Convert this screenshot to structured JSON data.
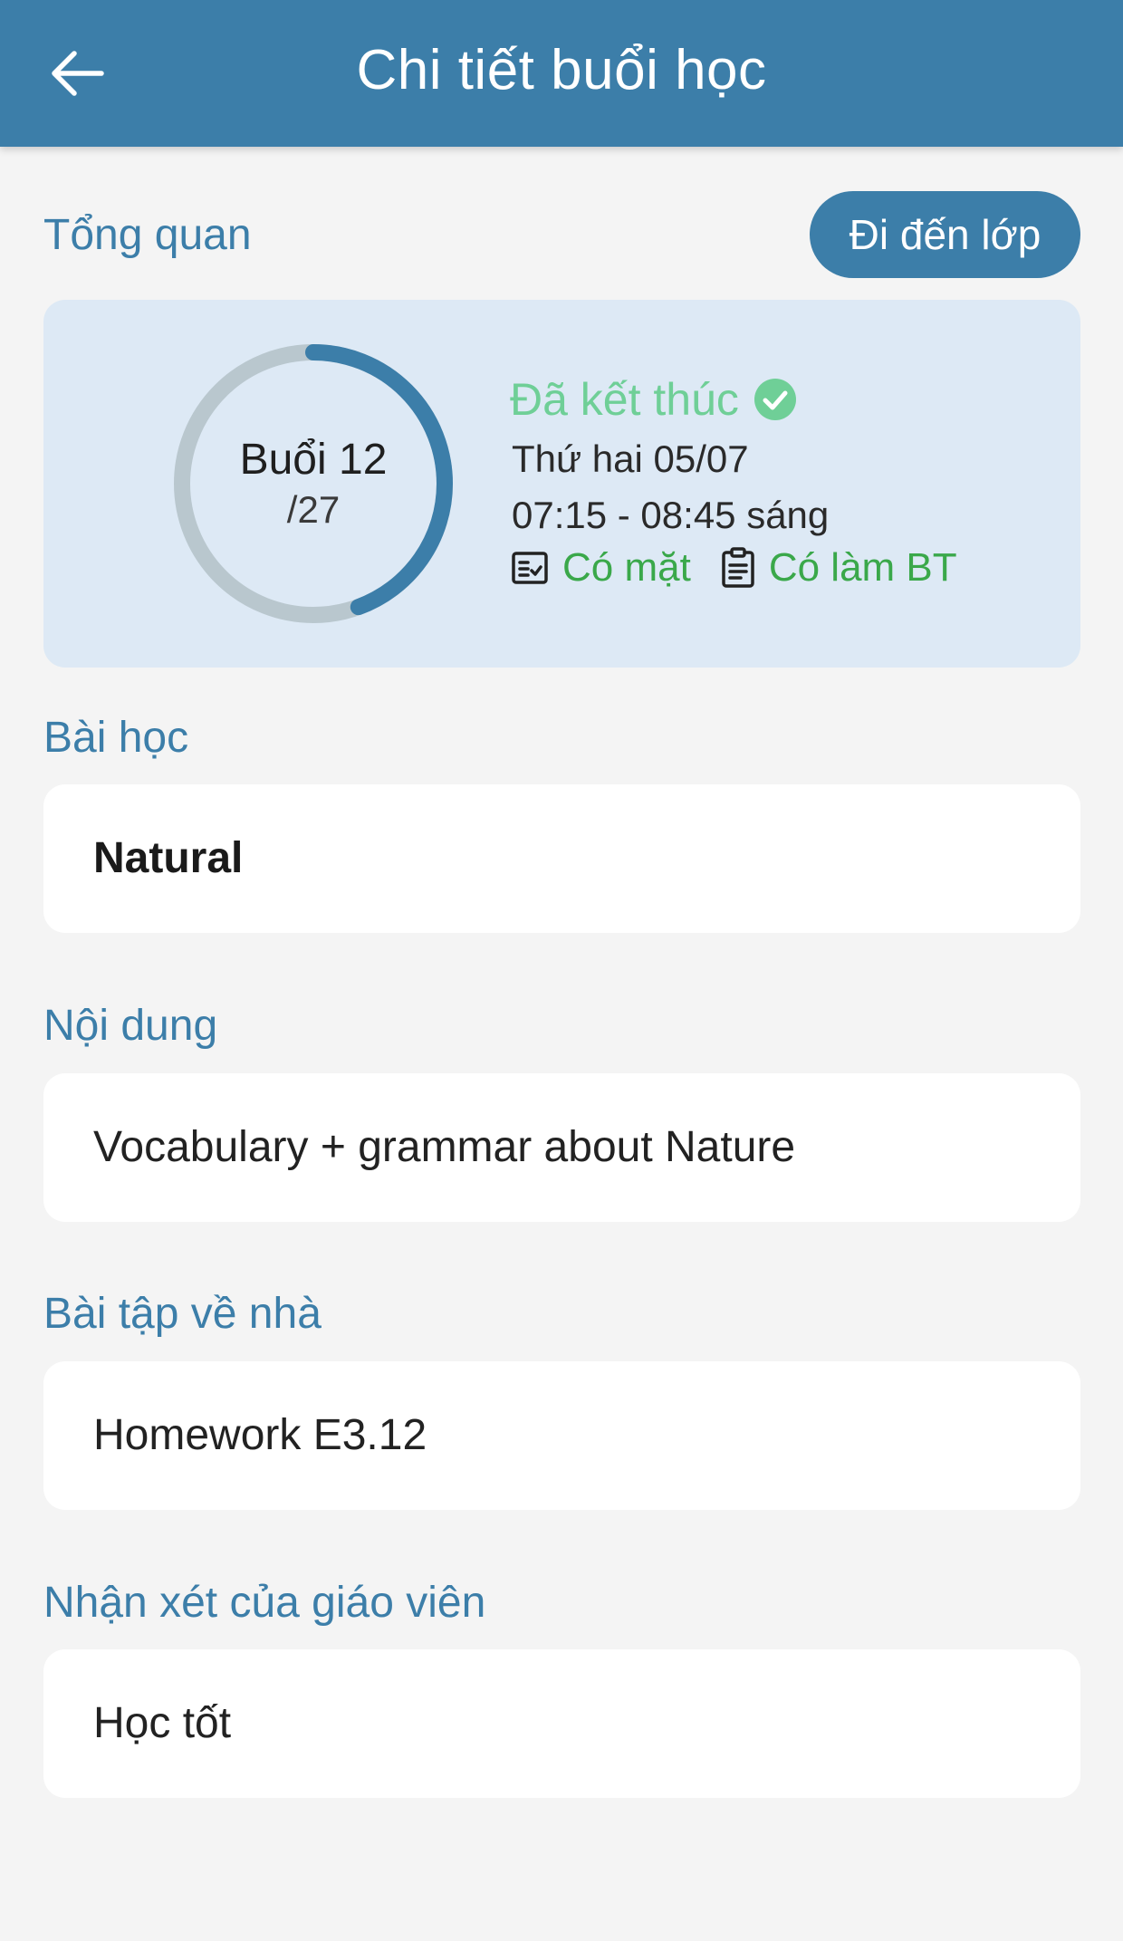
{
  "header": {
    "title": "Chi tiết buổi học"
  },
  "overview": {
    "section_title": "Tổng quan",
    "go_to_class_label": "Đi đến lớp",
    "session_label": "Buổi 12",
    "session_total": "/27",
    "progress_fraction": 0.444,
    "status": "Đã kết thúc",
    "date": "Thứ hai 05/07",
    "time": "07:15 - 08:45 sáng",
    "attendance": "Có mặt",
    "homework_status": "Có làm BT"
  },
  "lesson": {
    "section_title": "Bài học",
    "value": "Natural"
  },
  "content": {
    "section_title": "Nội dung",
    "value": "Vocabulary + grammar about Nature"
  },
  "homework": {
    "section_title": "Bài tập về nhà",
    "value": "Homework E3.12"
  },
  "teacher_comment": {
    "section_title": "Nhận xét của giáo viên",
    "value": "Học tốt"
  },
  "colors": {
    "primary": "#3c7ea9",
    "card_bg": "#dde9f5",
    "status_green": "#6fcf97",
    "badge_green": "#3aa84a",
    "ring_track": "#b9c7ce"
  },
  "icons": {
    "back": "arrow-left-icon",
    "status": "check-circle-icon",
    "attendance": "checklist-icon",
    "homework": "clipboard-icon"
  }
}
